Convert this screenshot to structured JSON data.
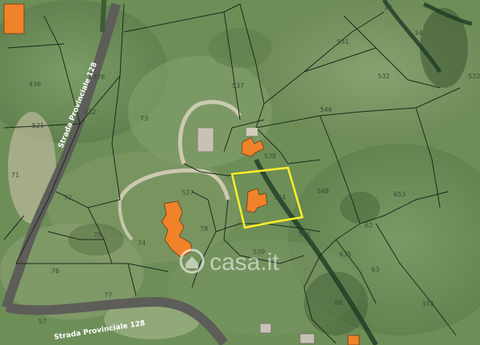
{
  "map": {
    "watermark": "casa.it",
    "roads": [
      "Strada Provinciale 128",
      "Strada Provinciale 128"
    ],
    "parcels": [
      "436",
      "426",
      "537",
      "531",
      "532",
      "34",
      "13",
      "546",
      "522",
      "73",
      "538",
      "544",
      "548",
      "653",
      "527",
      "74",
      "78",
      "72",
      "71",
      "75",
      "76",
      "77",
      "62",
      "63",
      "635",
      "539",
      "566",
      "86",
      "372",
      "432",
      "521",
      "57"
    ],
    "colors": {
      "vegetation": "#6f8f5a",
      "road": "#5d5d5a",
      "highlight": "#ffef2a",
      "building": "#f0822a",
      "parcel_line": "#1f2a1c"
    }
  }
}
